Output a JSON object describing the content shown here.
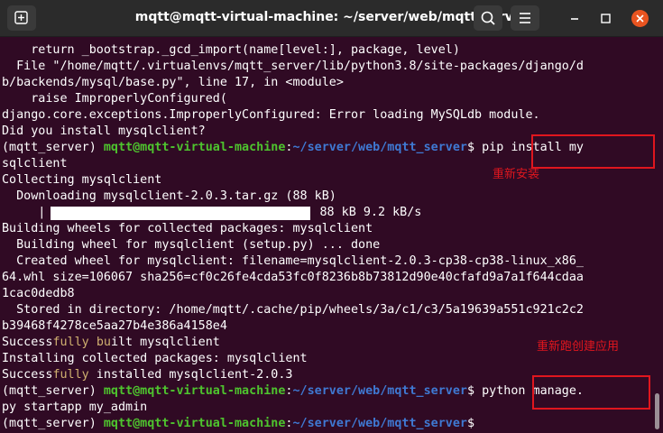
{
  "window": {
    "title": "mqtt@mqtt-virtual-machine: ~/server/web/mqtt_server",
    "accent_close": "#e95420",
    "buttons": [
      "new-tab-icon",
      "search-icon",
      "menu-icon",
      "minimize-icon",
      "maximize-icon",
      "close-icon"
    ]
  },
  "terminal": {
    "lines": [
      "    return _bootstrap._gcd_import(name[level:], package, level)",
      "  File \"/home/mqtt/.virtualenvs/mqtt_server/lib/python3.8/site-packages/django/d",
      "b/backends/mysql/base.py\", line 17, in <module>",
      "    raise ImproperlyConfigured(",
      "django.core.exceptions.ImproperlyConfigured: Error loading MySQLdb module.",
      "Did you install mysqlclient?",
      "sqlclient",
      "Collecting mysqlclient",
      "  Downloading mysqlclient-2.0.3.tar.gz (88 kB)",
      "Building wheels for collected packages: mysqlclient",
      "  Building wheel for mysqlclient (setup.py) ... done",
      "  Created wheel for mysqlclient: filename=mysqlclient-2.0.3-cp38-cp38-linux_x86_",
      "64.whl size=106067 sha256=cf0c26fe4cda53fc0f8236b8b73812d90e40cfafd9a7a1f644cdaa",
      "1cac0dedb8",
      "  Stored in directory: /home/mqtt/.cache/pip/wheels/3a/c1/c3/5a19639a551c921c2c2",
      "b39468f4278ce5aa27b4e386a4158e4",
      "Installing collected packages: mysqlclient",
      "py startapp my_admin"
    ],
    "prompt": {
      "env": "(mqtt_server) ",
      "userhost": "mqtt@mqtt-virtual-machine",
      "sep": ":",
      "path": "~/server/web/mqtt_server",
      "dollar": "$ "
    },
    "commands": [
      "pip install my",
      "python manage."
    ],
    "progress": {
      "left_edge": "     |",
      "right_text": "| 88 kB 9.2 kB/s",
      "fraction": 1.0
    },
    "success1": {
      "a": "Success",
      "b": "fully",
      "c": " ",
      "d": "bu",
      "e": "ilt mysqlclient"
    },
    "success2": {
      "a": "Success",
      "b": "fully",
      "c": " installed mysqlclient-2.0.3"
    },
    "annotations": [
      "重新安装",
      "重新跑创建应用"
    ],
    "annotation_color": "#e0161e"
  }
}
